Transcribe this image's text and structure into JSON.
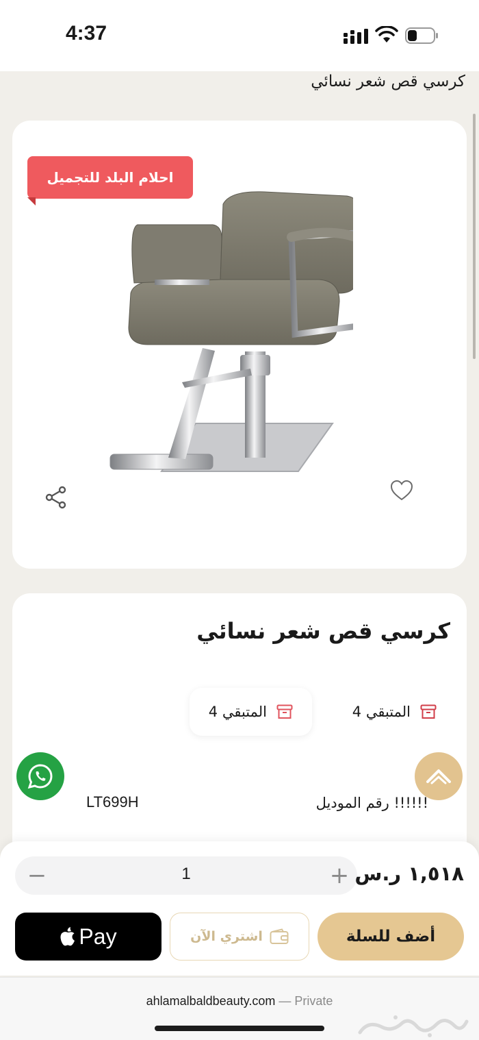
{
  "status_bar": {
    "time": "4:37"
  },
  "header": {
    "title": "كرسي قص شعر نسائي"
  },
  "image_card": {
    "badge": "احلام البلد للتجميل",
    "icons": {
      "wishlist": "heart-icon",
      "share": "share-icon"
    }
  },
  "product": {
    "title": "كرسي قص شعر نسائي",
    "stock": [
      {
        "label": "المتبقي 4",
        "icon": "box-icon"
      },
      {
        "label": "المتبقي 4",
        "icon": "box-icon"
      }
    ],
    "model_label": "!!!!!! رقم الموديل",
    "model_value": "LT699H"
  },
  "cart": {
    "quantity": "1",
    "price": "١,٥١٨ ر.س",
    "minus": "−",
    "plus": "+"
  },
  "buttons": {
    "apple_pay": "Pay",
    "buy_now": "اشتري الآن",
    "add_to_cart": "أضف للسلة"
  },
  "browser": {
    "url": "ahlamalbaldbeauty.com",
    "separator": " — ",
    "mode": "Private",
    "watermark": "حراج"
  },
  "colors": {
    "accent_gold": "#e5c792",
    "badge_red": "#ef5a5e",
    "whatsapp_green": "#25a244",
    "background": "#f1efea"
  }
}
